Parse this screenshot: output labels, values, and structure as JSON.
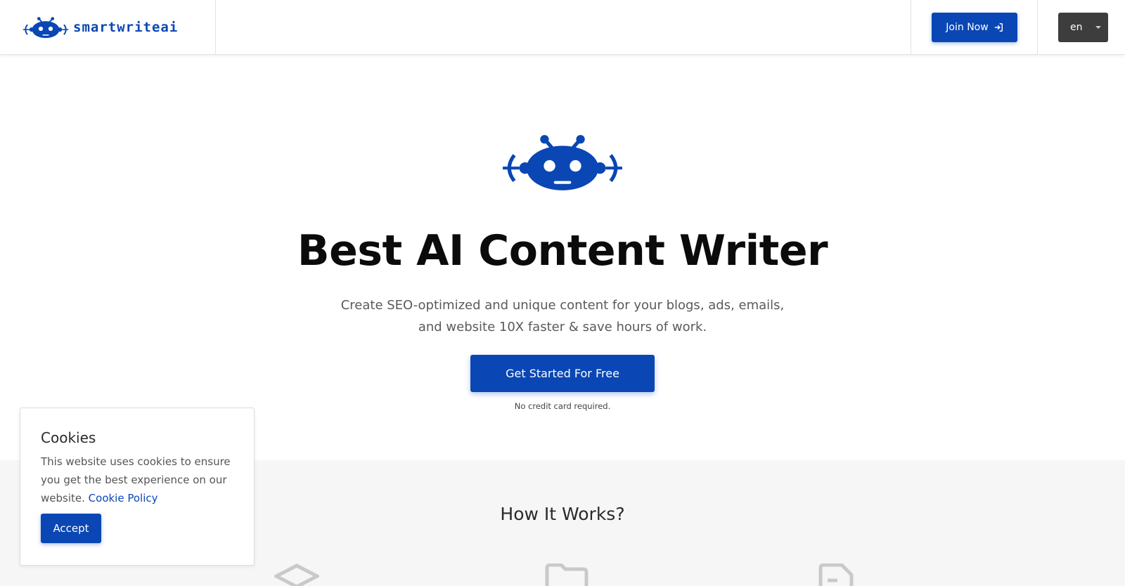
{
  "brand": {
    "name": "smartwriteai",
    "color": "#0a47b4"
  },
  "header": {
    "join_label": "Join Now",
    "join_icon": "sign-in-icon",
    "language": "en"
  },
  "hero": {
    "title": "Best AI Content Writer",
    "subtitle": "Create SEO-optimized and unique content for your blogs, ads, emails, and website 10X faster & save hours of work.",
    "cta_label": "Get Started For Free",
    "note": "No credit card required."
  },
  "how_it_works": {
    "title": "How It Works?",
    "step_icons": [
      "layers-icon",
      "folder-icon",
      "file-text-icon"
    ]
  },
  "cookie_banner": {
    "title": "Cookies",
    "text": "This website uses cookies to ensure you get the best experience on our website.",
    "link_label": "Cookie Policy",
    "accept_label": "Accept"
  }
}
